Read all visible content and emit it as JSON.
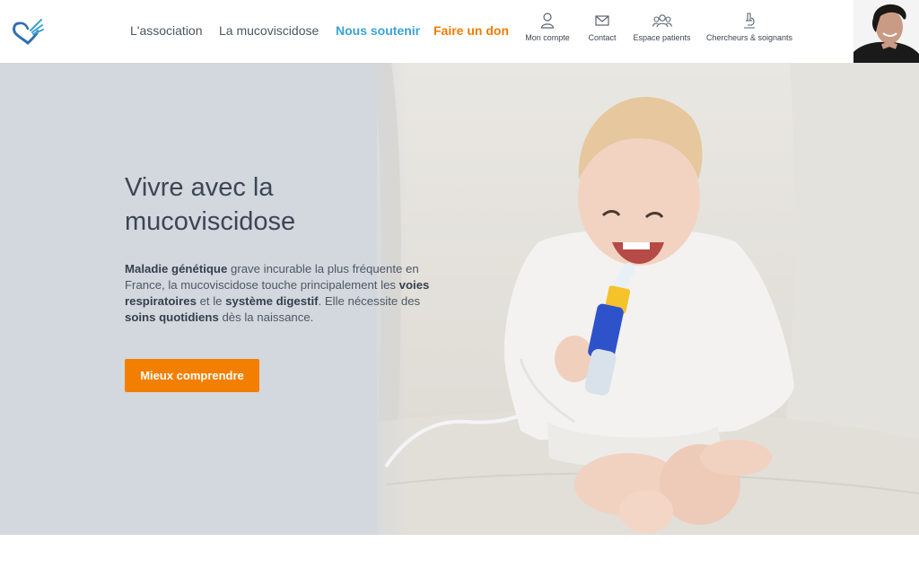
{
  "header": {
    "logo_icon": "winged-heart-logo",
    "nav": [
      {
        "label": "L'association"
      },
      {
        "label": "La mucoviscidose"
      },
      {
        "label": "Nous soutenir"
      },
      {
        "label": "Faire un don"
      }
    ],
    "utility": [
      {
        "label": "Mon compte",
        "icon": "user-icon"
      },
      {
        "label": "Contact",
        "icon": "envelope-icon"
      },
      {
        "label": "Espace patients",
        "icon": "group-icon"
      },
      {
        "label": "Chercheurs & soignants",
        "icon": "microscope-icon"
      }
    ],
    "colors": {
      "support": "#3aa3d6",
      "donate": "#f07c00"
    }
  },
  "hero": {
    "title_line1": "Vivre avec la",
    "title_line2": "mucoviscidose",
    "body": {
      "t1": "Maladie génétique",
      "t2": " grave incurable la plus fréquente en France, la mucoviscidose touche principalement les ",
      "t3": "voies respiratoires",
      "t4": " et le ",
      "t5": "système digestif",
      "t6": ". Elle nécessite des ",
      "t7": "soins quotidiens",
      "t8": " dès la naissance."
    },
    "cta_label": "Mieux comprendre",
    "colors": {
      "cta": "#f27f00",
      "panel": "#d3d7de"
    }
  }
}
